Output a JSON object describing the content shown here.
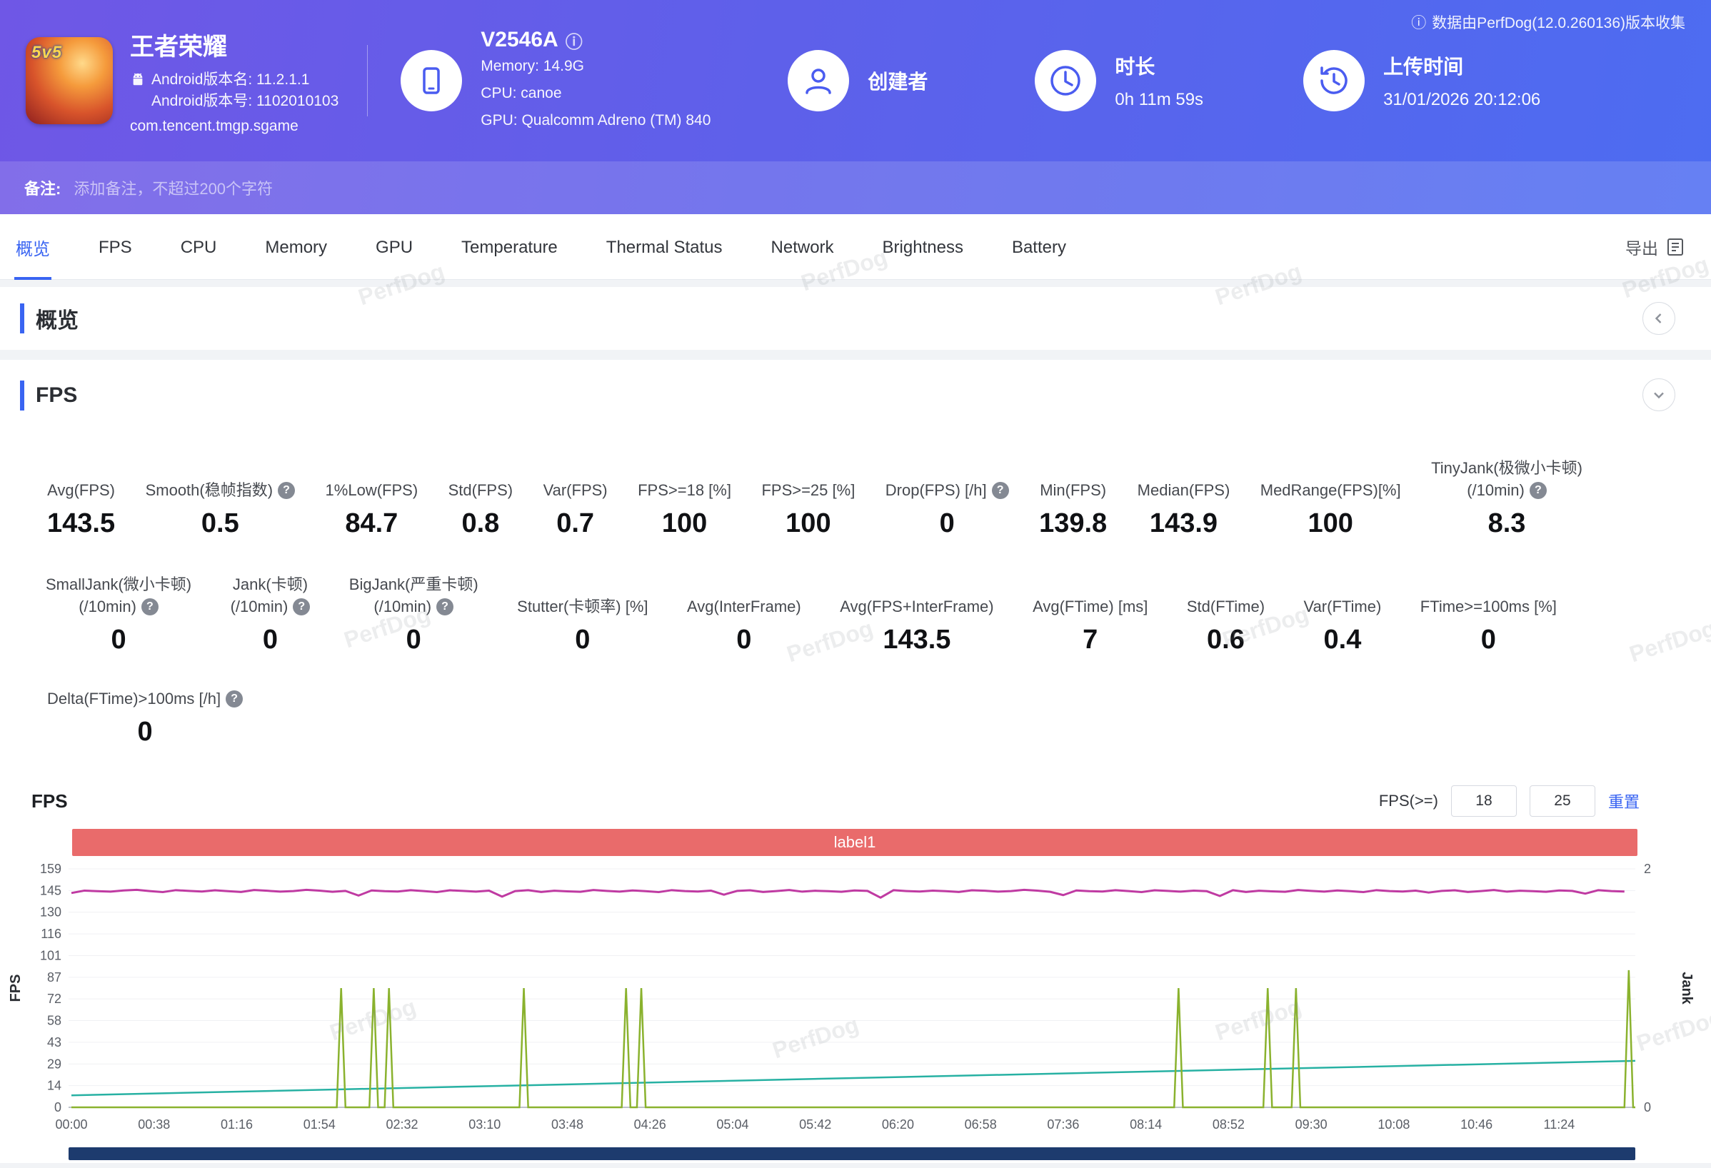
{
  "icons": {
    "info": "ⓘ",
    "help": "?"
  },
  "watermark": "PerfDog",
  "header": {
    "collect_info": "数据由PerfDog(12.0.260136)版本收集",
    "app": {
      "name": "王者荣耀",
      "badge": "5v5",
      "version_name_label": "Android版本名: 11.2.1.1",
      "version_code_label": "Android版本号: 1102010103",
      "package": "com.tencent.tmgp.sgame"
    },
    "device": {
      "model": "V2546A",
      "memory": "Memory: 14.9G",
      "cpu": "CPU: canoe",
      "gpu": "GPU: Qualcomm Adreno (TM) 840"
    },
    "creator": {
      "label": "创建者"
    },
    "duration": {
      "label": "时长",
      "value": "0h 11m 59s"
    },
    "upload": {
      "label": "上传时间",
      "value": "31/01/2026 20:12:06"
    }
  },
  "remark": {
    "label": "备注:",
    "placeholder": "添加备注，不超过200个字符"
  },
  "nav": {
    "tabs": [
      {
        "label": "概览",
        "slug": "overview",
        "active": true
      },
      {
        "label": "FPS",
        "slug": "fps",
        "active": false
      },
      {
        "label": "CPU",
        "slug": "cpu",
        "active": false
      },
      {
        "label": "Memory",
        "slug": "memory",
        "active": false
      },
      {
        "label": "GPU",
        "slug": "gpu",
        "active": false
      },
      {
        "label": "Temperature",
        "slug": "temperature",
        "active": false
      },
      {
        "label": "Thermal Status",
        "slug": "thermal-status",
        "active": false
      },
      {
        "label": "Network",
        "slug": "network",
        "active": false
      },
      {
        "label": "Brightness",
        "slug": "brightness",
        "active": false
      },
      {
        "label": "Battery",
        "slug": "battery",
        "active": false
      }
    ],
    "export_label": "导出"
  },
  "overview_section": {
    "title": "概览"
  },
  "fps_section": {
    "title": "FPS"
  },
  "metrics": {
    "row1": [
      {
        "label": "Avg(FPS)",
        "value": "143.5"
      },
      {
        "label": "Smooth(稳帧指数)",
        "help": true,
        "value": "0.5"
      },
      {
        "label": "1%Low(FPS)",
        "value": "84.7"
      },
      {
        "label": "Std(FPS)",
        "value": "0.8"
      },
      {
        "label": "Var(FPS)",
        "value": "0.7"
      },
      {
        "label": "FPS>=18 [%]",
        "value": "100"
      },
      {
        "label": "FPS>=25 [%]",
        "value": "100"
      },
      {
        "label": "Drop(FPS) [/h]",
        "help": true,
        "value": "0"
      },
      {
        "label": "Min(FPS)",
        "value": "139.8"
      },
      {
        "label": "Median(FPS)",
        "value": "143.9"
      },
      {
        "label": "MedRange(FPS)[%]",
        "value": "100"
      },
      {
        "label": "TinyJank(极微小卡顿)",
        "label2": "(/10min)",
        "help": true,
        "value": "8.3"
      }
    ],
    "row2": [
      {
        "label": "SmallJank(微小卡顿)",
        "label2": "(/10min)",
        "help": true,
        "value": "0"
      },
      {
        "label": "Jank(卡顿)",
        "label2": "(/10min)",
        "help": true,
        "value": "0"
      },
      {
        "label": "BigJank(严重卡顿)",
        "label2": "(/10min)",
        "help": true,
        "value": "0"
      },
      {
        "label": "Stutter(卡顿率) [%]",
        "value": "0"
      },
      {
        "label": "Avg(InterFrame)",
        "value": "0"
      },
      {
        "label": "Avg(FPS+InterFrame)",
        "value": "143.5"
      },
      {
        "label": "Avg(FTime) [ms]",
        "value": "7"
      },
      {
        "label": "Std(FTime)",
        "value": "0.6"
      },
      {
        "label": "Var(FTime)",
        "value": "0.4"
      },
      {
        "label": "FTime>=100ms [%]",
        "value": "0"
      }
    ],
    "row3": [
      {
        "label": "Delta(FTime)>100ms [/h]",
        "help": true,
        "value": "0"
      }
    ]
  },
  "chart_controls": {
    "title": "FPS",
    "filter_label": "FPS(>=)",
    "threshold1": "18",
    "threshold2": "25",
    "reset_label": "重置"
  },
  "chart_data": {
    "type": "line",
    "title": "FPS",
    "annotation_label": "label1",
    "duration_seconds": 719,
    "x_tick_interval_seconds": 38,
    "x_tick_labels": [
      "00:00",
      "00:38",
      "01:16",
      "01:54",
      "02:32",
      "03:10",
      "03:48",
      "04:26",
      "05:04",
      "05:42",
      "06:20",
      "06:58",
      "07:36",
      "08:14",
      "08:52",
      "09:30",
      "10:08",
      "10:46",
      "11:24"
    ],
    "left_axis": {
      "label": "FPS",
      "min": 0,
      "max": 159,
      "tick_labels": [
        "0",
        "14",
        "29",
        "43",
        "58",
        "72",
        "87",
        "101",
        "116",
        "130",
        "145",
        "159"
      ]
    },
    "right_axis": {
      "label": "Jank",
      "min": 0,
      "max": 2,
      "tick_labels": [
        "0",
        "2"
      ],
      "tick_values": [
        0,
        2
      ]
    },
    "grid": true,
    "legend": false,
    "series": [
      {
        "name": "FPS",
        "axis": "left",
        "color": "#bf3aa2",
        "sample_interval_seconds": 6,
        "values": [
          142.9,
          144.5,
          144.1,
          143.8,
          144.6,
          145,
          144.2,
          143.5,
          144.8,
          144.3,
          143.9,
          144.7,
          144.1,
          143.6,
          144.9,
          144.4,
          143.8,
          144.2,
          145,
          144.5,
          143.7,
          144.3,
          141.2,
          144.6,
          144.1,
          143.9,
          144.8,
          144.2,
          143.5,
          144.7,
          144.3,
          143.8,
          144.5,
          140.5,
          144.2,
          144.8,
          143.6,
          144.4,
          144,
          143.7,
          144.9,
          144.3,
          143.8,
          144.6,
          144.1,
          143.5,
          144.8,
          144.2,
          143.9,
          144.5,
          141.8,
          144.3,
          144.7,
          143.6,
          144.2,
          144.9,
          143.8,
          144.4,
          144.1,
          143.7,
          144.6,
          144.3,
          139.8,
          144.8,
          144.2,
          143.9,
          144.5,
          144.1,
          143.6,
          144.7,
          144.4,
          143.8,
          144.2,
          145,
          144.5,
          143.7,
          141.5,
          144.6,
          144.1,
          143.9,
          144.8,
          144.2,
          143.5,
          144.7,
          144.3,
          143.8,
          144.5,
          144.1,
          140.9,
          144.8,
          143.6,
          144.4,
          144,
          143.7,
          144.9,
          144.3,
          143.8,
          144.6,
          144.1,
          143.5,
          144.8,
          144.2,
          143.9,
          144.5,
          143.2,
          144.3,
          144.7,
          143.6,
          144.2,
          144.9,
          143.8,
          144.4,
          144.1,
          143.7,
          144.6,
          144.3,
          142.5,
          144.8,
          144.2,
          143.9
        ]
      },
      {
        "name": "Jank",
        "axis": "right",
        "color": "#8ab22e",
        "style": "event-spike",
        "events": [
          {
            "t": 124,
            "v": 1
          },
          {
            "t": 139,
            "v": 1
          },
          {
            "t": 146,
            "v": 1
          },
          {
            "t": 208,
            "v": 1
          },
          {
            "t": 255,
            "v": 1
          },
          {
            "t": 262,
            "v": 1
          },
          {
            "t": 509,
            "v": 1
          },
          {
            "t": 550,
            "v": 1
          },
          {
            "t": 563,
            "v": 1
          },
          {
            "t": 716,
            "v": 1.15
          }
        ]
      },
      {
        "name": "trend",
        "axis": "left",
        "color": "#27b1a3",
        "points": [
          [
            0,
            8
          ],
          [
            719,
            31
          ]
        ]
      }
    ]
  }
}
